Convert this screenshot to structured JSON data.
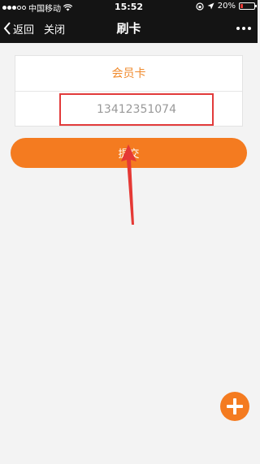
{
  "status_bar": {
    "carrier": "中国移动",
    "time": "15:52",
    "battery": "20%",
    "battery_level": 0.2,
    "signal_strength": 3,
    "icons": [
      "signal-dots-icon",
      "wifi-icon",
      "orientation-lock-icon",
      "location-icon",
      "battery-icon"
    ]
  },
  "nav": {
    "back_label": "返回",
    "close_label": "关闭",
    "title": "刷卡",
    "more_icon": "more-dots-icon"
  },
  "card": {
    "title": "会员卡",
    "input_value": "13412351074"
  },
  "submit_label": "提交",
  "fab_icon": "plus-icon",
  "colors": {
    "accent": "#f47b20",
    "card_title": "#f08a2c",
    "highlight_border": "#e23b3b",
    "nav_bg": "#141414",
    "page_bg": "#f3f3f3"
  }
}
